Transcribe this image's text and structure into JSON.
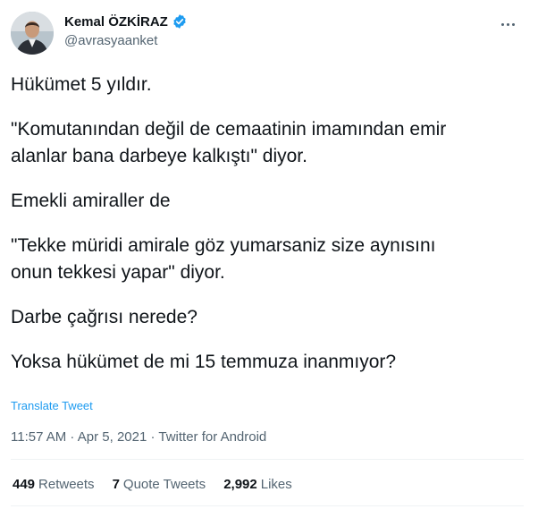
{
  "author": {
    "display_name": "Kemal ÖZKİRAZ",
    "handle": "@avrasyaanket",
    "verified": true
  },
  "tweet": {
    "paragraphs": [
      "Hükümet 5 yıldır.",
      "\"Komutanından değil de cemaatinin imamından emir\nalanlar bana darbeye kalkıştı\" diyor.",
      "Emekli amiraller de",
      "\"Tekke müridi amirale göz yumarsaniz size aynısını\nonun tekkesi yapar\" diyor.",
      "Darbe çağrısı nerede?",
      "Yoksa hükümet de mi 15 temmuza inanmıyor?"
    ],
    "translate_label": "Translate Tweet",
    "timestamp": "11:57 AM · Apr 5, 2021 · Twitter for Android"
  },
  "stats": {
    "retweets_count": "449",
    "retweets_label": "Retweets",
    "quotes_count": "7",
    "quotes_label": "Quote Tweets",
    "likes_count": "2,992",
    "likes_label": "Likes"
  },
  "colors": {
    "accent": "#1d9bf0",
    "text": "#0f1419",
    "secondary": "#536471",
    "divider": "#eff3f4"
  }
}
